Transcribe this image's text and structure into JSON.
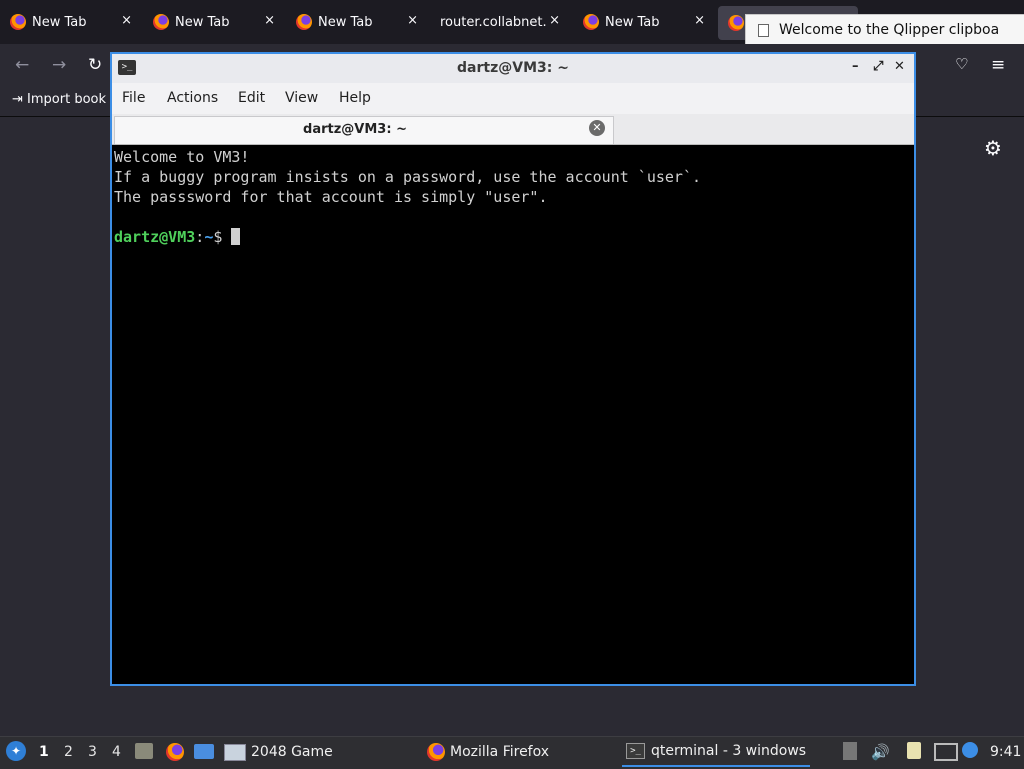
{
  "browser": {
    "tabs": [
      {
        "label": "New Tab",
        "close": "×"
      },
      {
        "label": "New Tab",
        "close": "×"
      },
      {
        "label": "New Tab",
        "close": "×"
      },
      {
        "label": "router.collabnet.l",
        "close": "×"
      },
      {
        "label": "New Tab",
        "close": "×"
      },
      {
        "label": "",
        "close": ""
      }
    ],
    "bookmarks_import": "Import book"
  },
  "tooltip": {
    "text": "Welcome to the Qlipper clipboa"
  },
  "terminal": {
    "title": "dartz@VM3: ~",
    "menu": [
      "File",
      "Actions",
      "Edit",
      "View",
      "Help"
    ],
    "tab_label": "dartz@VM3: ~",
    "lines": [
      "Welcome to VM3!",
      "If a buggy program insists on a password, use the account `user`.",
      "The passsword for that account is simply \"user\"."
    ],
    "prompt": {
      "user": "dartz@VM3",
      "colon": ":",
      "path": "~",
      "symbol": "$ "
    }
  },
  "panel": {
    "desktops": [
      "1",
      "2",
      "3",
      "4"
    ],
    "tasks": [
      {
        "label": "2048 Game",
        "icon": "window-icon"
      },
      {
        "label": "Mozilla Firefox",
        "icon": "firefox-icon"
      },
      {
        "label": "qterminal - 3 windows",
        "icon": "terminal-icon"
      }
    ],
    "clock": "9:41"
  },
  "colors": {
    "accent": "#3c8ee6",
    "prompt_user": "#4fd05b",
    "prompt_path": "#4aa3f0"
  }
}
